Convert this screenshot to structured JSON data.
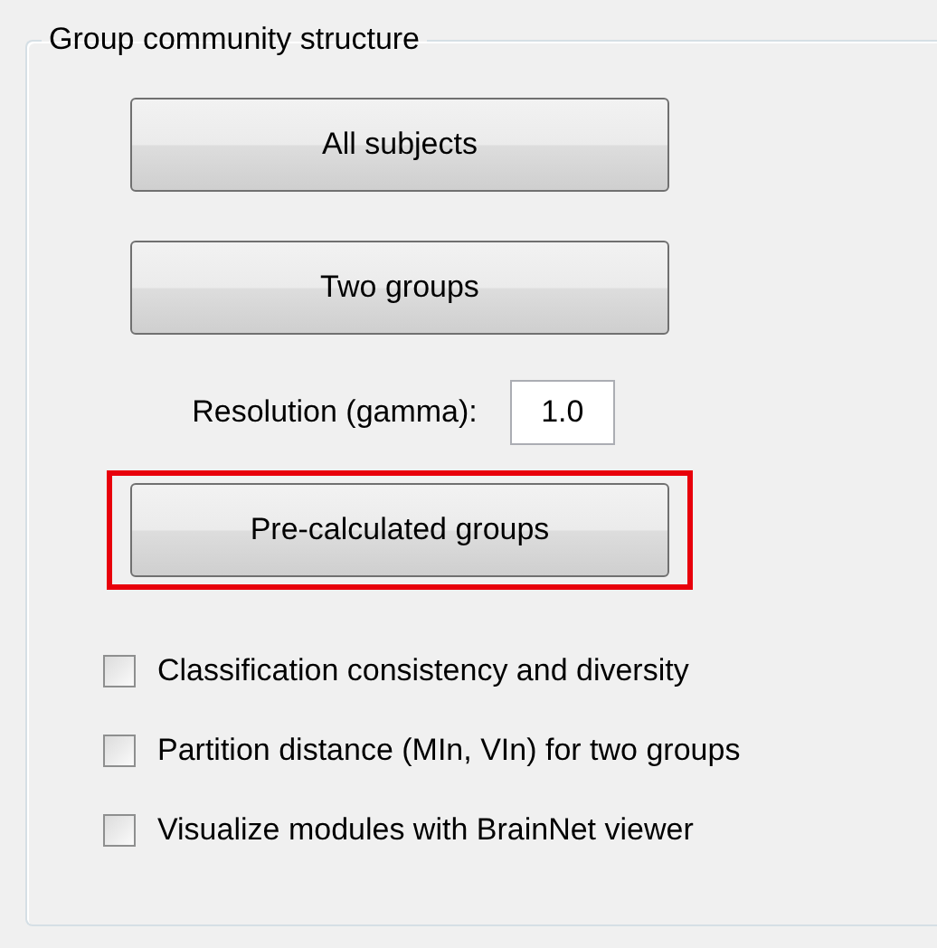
{
  "group_box": {
    "title": "Group community structure"
  },
  "buttons": [
    {
      "label": "All subjects",
      "highlighted": false
    },
    {
      "label": "Two groups",
      "highlighted": false
    }
  ],
  "resolution": {
    "label": "Resolution (gamma):",
    "value": "1.0"
  },
  "extra_button": {
    "label": "Pre-calculated groups",
    "highlighted": true
  },
  "options": [
    {
      "label": "Classification consistency and diversity",
      "checked": false
    },
    {
      "label": "Partition distance (MIn, VIn) for two groups",
      "checked": false
    },
    {
      "label": "Visualize modules with BrainNet viewer",
      "checked": false
    }
  ]
}
